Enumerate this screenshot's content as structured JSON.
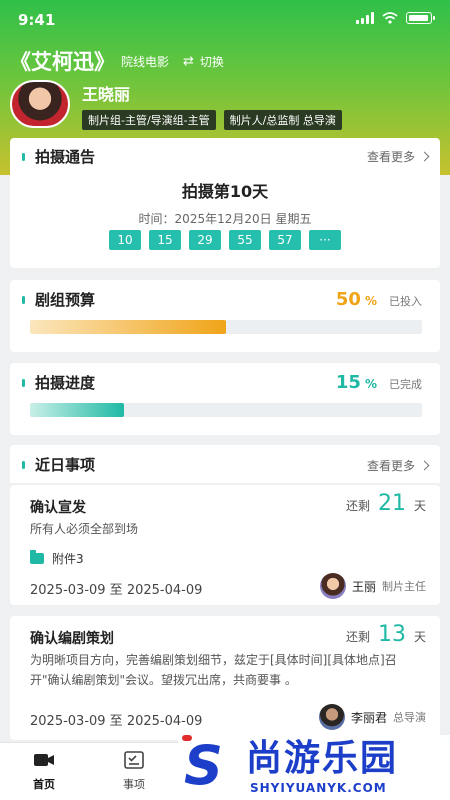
{
  "status": {
    "time": "9:41"
  },
  "project": {
    "title": "《艾柯迅》",
    "type": "院线电影",
    "switch_label": "切换"
  },
  "user": {
    "name": "王晓丽",
    "roles": [
      "制片组-主管/导演组-主管",
      "制片人/总监制 总导演"
    ]
  },
  "notice": {
    "title": "拍摄通告",
    "more": "查看更多",
    "day": "拍摄第10天",
    "time": "时间：2025年12月20日 星期五",
    "chips": [
      "10",
      "15",
      "29",
      "55",
      "57",
      "···"
    ]
  },
  "budget": {
    "title": "剧组预算",
    "percent": 50,
    "percent_text": "50",
    "symbol": "%",
    "note": "已投入",
    "color": "#f0a418"
  },
  "progress": {
    "title": "拍摄进度",
    "percent": 15,
    "percent_text": "15",
    "symbol": "%",
    "note": "已完成",
    "color": "#1fb9a5"
  },
  "events": {
    "title": "近日事项",
    "more": "查看更多",
    "items": [
      {
        "title": "确认宣发",
        "remain_label": "还剩",
        "days": "21",
        "days_unit": "天",
        "desc": "所有人必须全部到场",
        "attachment": "附件3",
        "date_range": "2025-03-09 至 2025-04-09",
        "person_name": "王丽",
        "person_role": "制片主任"
      },
      {
        "title": "确认编剧策划",
        "remain_label": "还剩",
        "days": "13",
        "days_unit": "天",
        "desc": "为明晰项目方向，完善编剧策划细节，兹定于[具体时间][具体地点]召开\"确认编剧策划\"会议。望拨冗出席，共商要事 。",
        "date_range": "2025-03-09 至 2025-04-09",
        "person_name": "李丽君",
        "person_role": "总导演"
      }
    ]
  },
  "tabs": [
    {
      "label": "首页",
      "icon": "camera-icon"
    },
    {
      "label": "事项",
      "icon": "checklist-icon"
    }
  ],
  "watermark": {
    "letter": "S",
    "cn": "尚游乐园",
    "en": "SHYIYUANYK.COM"
  }
}
